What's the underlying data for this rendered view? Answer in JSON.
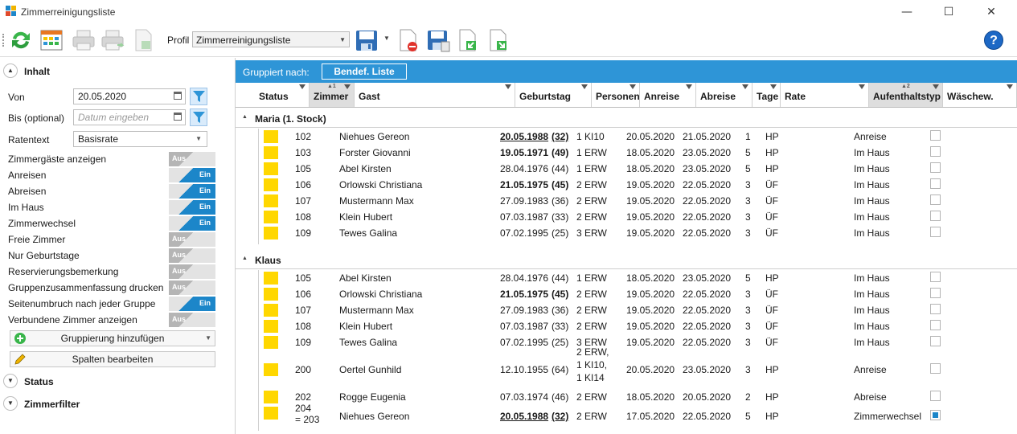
{
  "window": {
    "title": "Zimmerreinigungsliste",
    "minimize": "—",
    "maximize": "☐",
    "close": "✕"
  },
  "toolbar": {
    "profil_label": "Profil",
    "profil_value": "Zimmerreinigungsliste",
    "help": "?"
  },
  "left": {
    "inhalt": "Inhalt",
    "von_label": "Von",
    "von_value": "20.05.2020",
    "bis_label": "Bis (optional)",
    "bis_placeholder": "Datum eingeben",
    "ratentext_label": "Ratentext",
    "ratentext_value": "Basisrate",
    "on": "Ein",
    "off": "Aus",
    "options": [
      {
        "label": "Zimmergäste anzeigen",
        "on": false
      },
      {
        "label": "Anreisen",
        "on": true
      },
      {
        "label": "Abreisen",
        "on": true
      },
      {
        "label": "Im Haus",
        "on": true
      },
      {
        "label": "Zimmerwechsel",
        "on": true
      },
      {
        "label": "Freie Zimmer",
        "on": false
      },
      {
        "label": "Nur Geburtstage",
        "on": false
      },
      {
        "label": "Reservierungsbemerkung",
        "on": false
      },
      {
        "label": "Gruppenzusammenfassung drucken",
        "on": false
      },
      {
        "label": "Seitenumbruch nach jeder Gruppe",
        "on": true
      },
      {
        "label": "Verbundene Zimmer anzeigen",
        "on": false
      }
    ],
    "gruppierung_btn": "Gruppierung hinzufügen",
    "spalten_btn": "Spalten bearbeiten",
    "status": "Status",
    "zimmerfilter": "Zimmerfilter"
  },
  "grouping": {
    "label": "Gruppiert nach:",
    "chip": "Bendef. Liste"
  },
  "columns": [
    "Status",
    "Zimmer",
    "Gast",
    "Geburtstag",
    "Personen",
    "Anreise",
    "Abreise",
    "Tage",
    "Rate",
    "Aufenthaltstyp",
    "Wäschew."
  ],
  "sort_indicators": {
    "zimmer": "▲1",
    "aufenthaltstyp": "▲2"
  },
  "groups": [
    {
      "name": "Maria (1. Stock)",
      "rows": [
        {
          "zimmer": "102",
          "gast": "Niehues Gereon",
          "geb": "20.05.1988",
          "alter": "(32)",
          "pers": "1 KI10",
          "an": "20.05.2020",
          "ab": "21.05.2020",
          "tage": "1",
          "rate": "HP",
          "typ": "Anreise"
        },
        {
          "zimmer": "103",
          "gast": "Forster Giovanni",
          "geb": "19.05.1971",
          "alter": "(49)",
          "pers": "1 ERW",
          "an": "18.05.2020",
          "ab": "23.05.2020",
          "tage": "5",
          "rate": "HP",
          "typ": "Im Haus"
        },
        {
          "zimmer": "105",
          "gast": "Abel Kirsten",
          "geb": "28.04.1976",
          "alter": "(44)",
          "pers": "1 ERW",
          "an": "18.05.2020",
          "ab": "23.05.2020",
          "tage": "5",
          "rate": "HP",
          "typ": "Im Haus"
        },
        {
          "zimmer": "106",
          "gast": "Orlowski Christiana",
          "geb": "21.05.1975",
          "alter": "(45)",
          "pers": "2 ERW",
          "an": "19.05.2020",
          "ab": "22.05.2020",
          "tage": "3",
          "rate": "ÜF",
          "typ": "Im Haus"
        },
        {
          "zimmer": "107",
          "gast": "Mustermann Max",
          "geb": "27.09.1983",
          "alter": "(36)",
          "pers": "2 ERW",
          "an": "19.05.2020",
          "ab": "22.05.2020",
          "tage": "3",
          "rate": "ÜF",
          "typ": "Im Haus"
        },
        {
          "zimmer": "108",
          "gast": "Klein Hubert",
          "geb": "07.03.1987",
          "alter": "(33)",
          "pers": "2 ERW",
          "an": "19.05.2020",
          "ab": "22.05.2020",
          "tage": "3",
          "rate": "ÜF",
          "typ": "Im Haus"
        },
        {
          "zimmer": "109",
          "gast": "Tewes Galina",
          "geb": "07.02.1995",
          "alter": "(25)",
          "pers": "3 ERW",
          "an": "19.05.2020",
          "ab": "22.05.2020",
          "tage": "3",
          "rate": "ÜF",
          "typ": "Im Haus"
        }
      ]
    },
    {
      "name": "Klaus",
      "rows": [
        {
          "zimmer": "105",
          "gast": "Abel Kirsten",
          "geb": "28.04.1976",
          "alter": "(44)",
          "pers": "1 ERW",
          "an": "18.05.2020",
          "ab": "23.05.2020",
          "tage": "5",
          "rate": "HP",
          "typ": "Im Haus"
        },
        {
          "zimmer": "106",
          "gast": "Orlowski Christiana",
          "geb": "21.05.1975",
          "alter": "(45)",
          "pers": "2 ERW",
          "an": "19.05.2020",
          "ab": "22.05.2020",
          "tage": "3",
          "rate": "ÜF",
          "typ": "Im Haus"
        },
        {
          "zimmer": "107",
          "gast": "Mustermann Max",
          "geb": "27.09.1983",
          "alter": "(36)",
          "pers": "2 ERW",
          "an": "19.05.2020",
          "ab": "22.05.2020",
          "tage": "3",
          "rate": "ÜF",
          "typ": "Im Haus"
        },
        {
          "zimmer": "108",
          "gast": "Klein Hubert",
          "geb": "07.03.1987",
          "alter": "(33)",
          "pers": "2 ERW",
          "an": "19.05.2020",
          "ab": "22.05.2020",
          "tage": "3",
          "rate": "ÜF",
          "typ": "Im Haus"
        },
        {
          "zimmer": "109",
          "gast": "Tewes Galina",
          "geb": "07.02.1995",
          "alter": "(25)",
          "pers": "3 ERW",
          "an": "19.05.2020",
          "ab": "22.05.2020",
          "tage": "3",
          "rate": "ÜF",
          "typ": "Im Haus"
        },
        {
          "zimmer": "200",
          "gast": "Oertel Gunhild",
          "geb": "12.10.1955",
          "alter": "(64)",
          "pers_lines": [
            "2 ERW,",
            "1 KI10,",
            "1 KI14"
          ],
          "an": "20.05.2020",
          "ab": "23.05.2020",
          "tage": "3",
          "rate": "HP",
          "typ": "Anreise"
        },
        {
          "zimmer": "202",
          "gast": "Rogge Eugenia",
          "geb": "07.03.1974",
          "alter": "(46)",
          "pers": "2 ERW",
          "an": "18.05.2020",
          "ab": "20.05.2020",
          "tage": "2",
          "rate": "HP",
          "typ": "Abreise"
        },
        {
          "zimmer_lines": [
            "204",
            "= 203"
          ],
          "gast": "Niehues Gereon",
          "geb": "20.05.1988",
          "alter": "(32)",
          "pers": "2 ERW",
          "an": "17.05.2020",
          "ab": "22.05.2020",
          "tage": "5",
          "rate": "HP",
          "typ": "Zimmerwechsel",
          "checked": true
        }
      ]
    }
  ]
}
